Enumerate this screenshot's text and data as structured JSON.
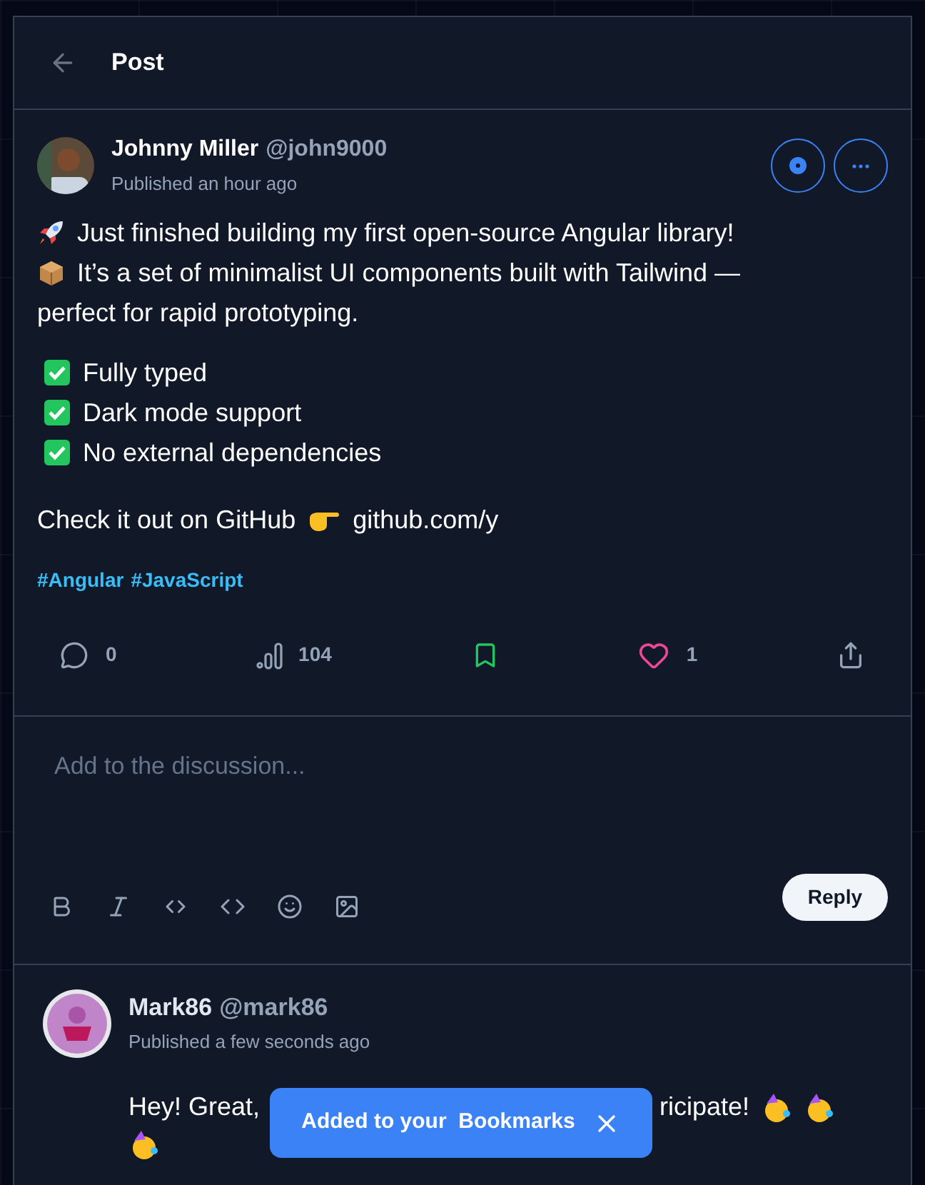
{
  "header": {
    "title": "Post"
  },
  "post": {
    "author": "Johnny Miller",
    "handle": "@john9000",
    "time": "Published an hour ago",
    "lines": [
      {
        "kind": "rocket",
        "text": "Just finished building my first open-source Angular library!"
      },
      {
        "kind": "package",
        "text": "It’s a set of minimalist UI components built with Tailwind —"
      },
      {
        "kind": "plain",
        "text": "perfect for rapid prototyping."
      }
    ],
    "checklist": [
      "Fully typed",
      "Dark mode support",
      "No external dependencies"
    ],
    "cta": {
      "text": "Check it out on GitHub",
      "link": "github.com/y"
    },
    "tags": [
      "#Angular",
      "#JavaScript"
    ],
    "stats": {
      "comments": "0",
      "views": "104",
      "bookmarked": true,
      "liked": true,
      "likes": "1"
    }
  },
  "composer": {
    "placeholder": "Add to the discussion...",
    "submit": "Reply"
  },
  "comment": {
    "author": "Mark86",
    "handle": "@mark86",
    "time": "Published a few seconds ago",
    "text_start": "Hey! Great,",
    "text_end": "ricipate!"
  },
  "toast": {
    "text": "Added to your  Bookmarks"
  }
}
